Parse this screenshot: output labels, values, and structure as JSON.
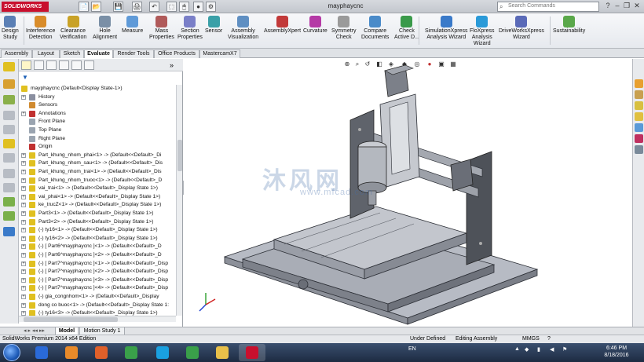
{
  "window": {
    "brand": "SOLIDWORKS",
    "document_title": "mayphaycnc",
    "search_placeholder": "Search Commands",
    "controls": [
      "?",
      "–",
      "❐",
      "✕"
    ]
  },
  "quick_access": [
    "📄",
    "📂",
    "💾",
    "🖨",
    "↶",
    "⬚",
    "🖱",
    "●",
    "⚙"
  ],
  "command_manager": [
    {
      "label": "Design\nStudy",
      "color": "#5a7fb5"
    },
    {
      "label": "Interference\nDetection",
      "color": "#d98c2a"
    },
    {
      "label": "Clearance\nVerification",
      "color": "#c9a227"
    },
    {
      "label": "Hole\nAlignment",
      "color": "#7a8fa6"
    },
    {
      "label": "Measure",
      "color": "#5f9ad8"
    },
    {
      "label": "Mass\nProperties",
      "color": "#b05a5a"
    },
    {
      "label": "Section\nProperties",
      "color": "#7a7fc8"
    },
    {
      "label": "Sensor",
      "color": "#3aa0a8"
    },
    {
      "label": "Assembly\nVisualization",
      "color": "#5f8fc2"
    },
    {
      "label": "AssemblyXpert",
      "color": "#c23a3a"
    },
    {
      "label": "Curvature",
      "color": "#b53aa6"
    },
    {
      "label": "Symmetry\nCheck",
      "color": "#9a9a9a"
    },
    {
      "label": "Compare\nDocuments",
      "color": "#4a8bc9"
    },
    {
      "label": "Check\nActive D...",
      "color": "#3a9a4a"
    },
    {
      "label": "SimulationXpress\nAnalysis Wizard",
      "color": "#3a7ac9"
    },
    {
      "label": "FloXpress\nAnalysis\nWizard",
      "color": "#2a9ad8"
    },
    {
      "label": "DriveWorksXpress\nWizard",
      "color": "#5a6ab8"
    },
    {
      "label": "Sustainability",
      "color": "#5aa84a"
    }
  ],
  "tabs": [
    {
      "label": "Assembly",
      "active": false
    },
    {
      "label": "Layout",
      "active": false
    },
    {
      "label": "Sketch",
      "active": false
    },
    {
      "label": "Evaluate",
      "active": true
    },
    {
      "label": "Render Tools",
      "active": false
    },
    {
      "label": "Office Products",
      "active": false
    },
    {
      "label": "MastercamX7",
      "active": false
    }
  ],
  "feature_tree": [
    {
      "text": "mayphaycnc  (Default<Display State-1>)",
      "expand": "",
      "icon": "#e0c020",
      "indent": 0
    },
    {
      "text": "History",
      "expand": "+",
      "icon": "#8a8fa0",
      "indent": 1
    },
    {
      "text": "Sensors",
      "expand": "",
      "icon": "#d08a30",
      "indent": 1
    },
    {
      "text": "Annotations",
      "expand": "+",
      "icon": "#c03030",
      "indent": 1
    },
    {
      "text": "Front Plane",
      "expand": "",
      "icon": "#9aa4b0",
      "indent": 1
    },
    {
      "text": "Top Plane",
      "expand": "",
      "icon": "#9aa4b0",
      "indent": 1
    },
    {
      "text": "Right Plane",
      "expand": "",
      "icon": "#9aa4b0",
      "indent": 1
    },
    {
      "text": "Origin",
      "expand": "",
      "icon": "#c03030",
      "indent": 1
    },
    {
      "text": "Part_khung_nhom_phai<1> -> (Default<<Default>_Di",
      "expand": "+",
      "icon": "#e0c020",
      "indent": 1
    },
    {
      "text": "Part_khung_nhom_sau<1> -> (Default<<Default>_Dis",
      "expand": "+",
      "icon": "#e0c020",
      "indent": 1
    },
    {
      "text": "Part_khung_nhom_trai<1> -> (Default<<Default>_Dis",
      "expand": "+",
      "icon": "#e0c020",
      "indent": 1
    },
    {
      "text": "Part_khung_nhom_truoc<1> -> (Default<<Default>_D",
      "expand": "+",
      "icon": "#e0c020",
      "indent": 1
    },
    {
      "text": "vai_trai<1> -> (Default<<Default>_Display State 1>)",
      "expand": "+",
      "icon": "#e0c020",
      "indent": 1
    },
    {
      "text": "vai_phai<1> -> (Default<<Default>_Display State 1>)",
      "expand": "+",
      "icon": "#e0c020",
      "indent": 1
    },
    {
      "text": "ke_trucZ<1> -> (Default<<Default>_Display State 1>)",
      "expand": "+",
      "icon": "#e0c020",
      "indent": 1
    },
    {
      "text": "Part3<1> -> (Default<<Default>_Display State 1>)",
      "expand": "+",
      "icon": "#e0c020",
      "indent": 1
    },
    {
      "text": "Part3<2> -> (Default<<Default>_Display State 1>)",
      "expand": "+",
      "icon": "#e0c020",
      "indent": 1
    },
    {
      "text": "(-) ty16<1> -> (Default<<Default>_Display State 1>)",
      "expand": "+",
      "icon": "#e0c020",
      "indent": 1
    },
    {
      "text": "(-) ty16<2> -> (Default<<Default>_Display State 1>)",
      "expand": "+",
      "icon": "#e0c020",
      "indent": 1
    },
    {
      "text": "(-) [ Part6^mayphaycnc ]<1> -> (Default<<Default>_D",
      "expand": "+",
      "icon": "#e0c020",
      "indent": 1
    },
    {
      "text": "(-) [ Part6^mayphaycnc ]<2> -> (Default<<Default>_D",
      "expand": "+",
      "icon": "#e0c020",
      "indent": 1
    },
    {
      "text": "(-) [ Part7^mayphaycnc ]<1> -> (Default<<Default>_Disp",
      "expand": "+",
      "icon": "#e0c020",
      "indent": 1
    },
    {
      "text": "(-) [ Part7^mayphaycnc ]<2> -> (Default<<Default>_Disp",
      "expand": "+",
      "icon": "#e0c020",
      "indent": 1
    },
    {
      "text": "(-) [ Part7^mayphaycnc ]<3> -> (Default<<Default>_Disp",
      "expand": "+",
      "icon": "#e0c020",
      "indent": 1
    },
    {
      "text": "(-) [ Part7^mayphaycnc ]<4> -> (Default<<Default>_Disp",
      "expand": "+",
      "icon": "#e0c020",
      "indent": 1
    },
    {
      "text": "(-) gia_congnhom<1> -> (Default<<Default>_Display",
      "expand": "+",
      "icon": "#e0c020",
      "indent": 1
    },
    {
      "text": "dong co buoc<1> -> (Default<<Default>_Display State 1:",
      "expand": "+",
      "icon": "#e0c020",
      "indent": 1
    },
    {
      "text": "(-) ty16<3> -> (Default<<Default>_Display State 1>)",
      "expand": "+",
      "icon": "#e0c020",
      "indent": 1
    }
  ],
  "watermark": {
    "text": "沐风网",
    "sub": "www.mfcad.com"
  },
  "bottom_tabs": [
    {
      "label": "Model",
      "active": true
    },
    {
      "label": "Motion Study 1",
      "active": false
    }
  ],
  "status": {
    "product": "SolidWorks Premium 2014 x64 Edition",
    "state": "Under Defined",
    "mode": "Editing Assembly",
    "units": "MMGS",
    "help": "?"
  },
  "taskbar": {
    "apps": [
      {
        "name": "explorer-ie",
        "color": "#2a6ad8"
      },
      {
        "name": "media-player",
        "color": "#e88a2a"
      },
      {
        "name": "firefox",
        "color": "#e0602a"
      },
      {
        "name": "chrome",
        "color": "#3aa04a"
      },
      {
        "name": "skype",
        "color": "#1aa0e0"
      },
      {
        "name": "chrome-2",
        "color": "#3aa04a"
      },
      {
        "name": "file-explorer",
        "color": "#e8c04a"
      },
      {
        "name": "solidworks",
        "color": "#c8102e"
      }
    ],
    "lang": "EN",
    "time": "6:46 PM",
    "date": "8/18/2016"
  }
}
